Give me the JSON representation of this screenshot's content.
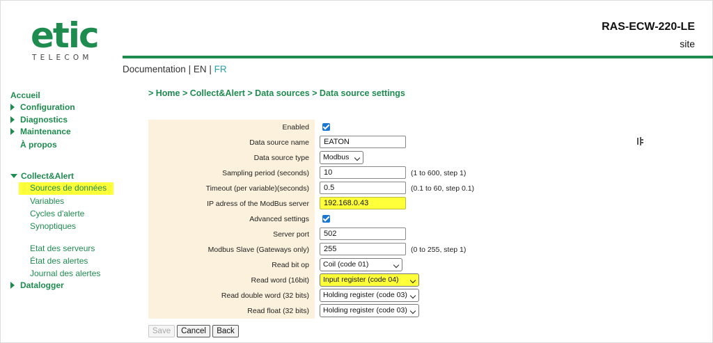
{
  "header": {
    "logo_word": "etic",
    "logo_sub": "TELECOM",
    "device_name": "RAS-ECW-220-LE",
    "site": "site",
    "doc_label": "Documentation",
    "sep1": " | ",
    "lang_en": "EN",
    "sep2": " | ",
    "lang_fr": "FR"
  },
  "sidebar": {
    "accueil": "Accueil",
    "configuration": "Configuration",
    "diagnostics": "Diagnostics",
    "maintenance": "Maintenance",
    "apropos": "À propos",
    "collect_alert": "Collect&Alert",
    "sub": {
      "sources": "Sources de données",
      "variables": "Variables",
      "cycles": "Cycles d'alerte",
      "synoptiques": "Synoptiques",
      "etat_serveurs": "Etat des serveurs",
      "etat_alertes": "État des alertes",
      "journal": "Journal des alertes"
    },
    "datalogger": "Datalogger"
  },
  "breadcrumb": "> Home > Collect&Alert > Data sources > Data source settings",
  "form": {
    "enabled_label": "Enabled",
    "name_label": "Data source name",
    "name_value": "EATON",
    "type_label": "Data source type",
    "type_value": "Modbus",
    "sampling_label": "Sampling period (seconds)",
    "sampling_value": "10",
    "sampling_hint": "(1 to 600, step 1)",
    "timeout_label": "Timeout (per variable)(seconds)",
    "timeout_value": "0.5",
    "timeout_hint": "(0.1 to 60, step 0.1)",
    "ip_label": "IP adress of the ModBus server",
    "ip_value": "192.168.0.43",
    "advanced_label": "Advanced settings",
    "port_label": "Server port",
    "port_value": "502",
    "slave_label": "Modbus Slave (Gateways only)",
    "slave_value": "255",
    "slave_hint": "(0 to 255, step 1)",
    "readbit_label": "Read bit op",
    "readbit_value": "Coil (code 01)",
    "readword_label": "Read word (16bit)",
    "readword_value": "Input register (code 04)",
    "readdouble_label": "Read double word (32 bits)",
    "readdouble_value": "Holding register (code 03)",
    "readfloat_label": "Read float (32 bits)",
    "readfloat_value": "Holding register (code 03)"
  },
  "buttons": {
    "save": "Save",
    "cancel": "Cancel",
    "back": "Back"
  },
  "colors": {
    "brand_green": "#1e8b4f",
    "highlight": "#ffff3a",
    "label_bg": "#fbf1dc",
    "checkbox_blue": "#1976d2"
  }
}
